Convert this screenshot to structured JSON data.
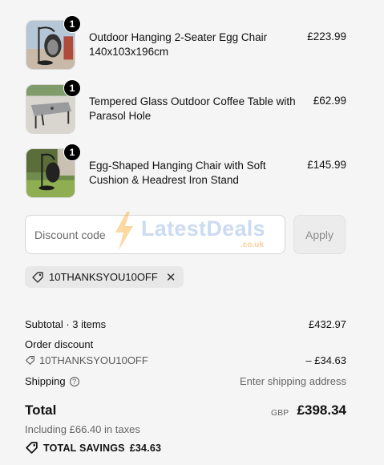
{
  "items": [
    {
      "qty": "1",
      "name_line1": "Outdoor Hanging 2-Seater Egg Chair",
      "name_line2": "140x103x196cm",
      "price": "£223.99",
      "image": "egg-chair-photo"
    },
    {
      "qty": "1",
      "name_line1": "Tempered Glass Outdoor Coffee Table with",
      "name_line2": "Parasol Hole",
      "price": "£62.99",
      "image": "coffee-table-photo"
    },
    {
      "qty": "1",
      "name_line1": "Egg-Shaped Hanging Chair with Soft",
      "name_line2": "Cushion & Headrest Iron Stand",
      "price": "£145.99",
      "image": "hanging-chair-photo"
    }
  ],
  "discount": {
    "placeholder": "Discount code",
    "value": "",
    "apply_label": "Apply",
    "applied_code": "10THANKSYOU10OFF"
  },
  "watermark": {
    "text": "LatestDeals",
    "sub": ".co.uk"
  },
  "summary": {
    "subtotal_label": "Subtotal · 3 items",
    "subtotal_value": "£432.97",
    "order_discount_label": "Order discount",
    "discount_code": "10THANKSYOU10OFF",
    "discount_value": "– £34.63",
    "shipping_label": "Shipping",
    "shipping_hint": "Enter shipping address",
    "total_label": "Total",
    "currency": "GBP",
    "total_value": "£398.34",
    "tax_note": "Including £66.40 in taxes",
    "savings_label": "TOTAL SAVINGS",
    "savings_value": "£34.63"
  },
  "colors": {
    "background": "#f5f5f5",
    "badge": "#000000",
    "chip": "#e8e8e8"
  }
}
